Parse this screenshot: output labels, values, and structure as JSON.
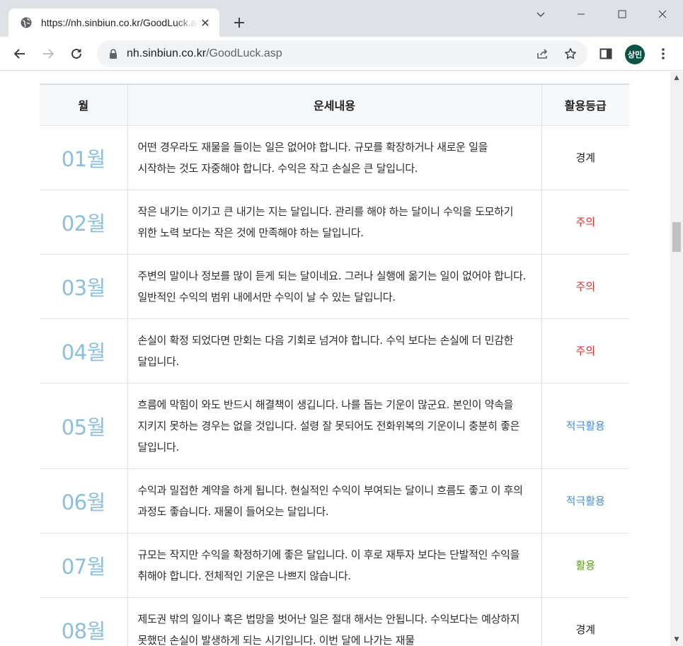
{
  "browser": {
    "tab_title": "https://nh.sinbiun.co.kr/GoodLuck.asp",
    "url_domain": "nh.sinbiun.co.kr",
    "url_path": "/GoodLuck.asp",
    "profile_initials": "상민"
  },
  "table": {
    "headers": {
      "month": "월",
      "content": "운세내용",
      "grade": "활용등급"
    },
    "rows": [
      {
        "month": "01월",
        "content": "어떤 경우라도 재물을 들이는 일은 없어야 합니다. 규모를 확장하거나 새로운 일을 시작하는 것도 자중해야 합니다. 수익은 작고 손실은 큰 달입니다.",
        "grade": "경계",
        "grade_color": "#222222"
      },
      {
        "month": "02월",
        "content": "작은 내기는 이기고 큰 내기는 지는 달입니다. 관리를 해야 하는 달이니 수익을 도모하기 위한 노력 보다는 작은 것에 만족해야 하는 달입니다.",
        "grade": "주의",
        "grade_color": "#e0312b"
      },
      {
        "month": "03월",
        "content": "주변의 말이나 정보를 많이 듣게 되는 달이네요. 그러나 실행에 옮기는 일이 없어야 합니다. 일반적인 수익의 범위 내에서만 수익이 날 수 있는 달입니다.",
        "grade": "주의",
        "grade_color": "#e0312b"
      },
      {
        "month": "04월",
        "content": "손실이 확정 되었다면 만회는 다음 기회로 넘겨야 합니다. 수익 보다는 손실에 더 민감한 달입니다.",
        "grade": "주의",
        "grade_color": "#e0312b"
      },
      {
        "month": "05월",
        "content": "흐름에 막힘이 와도 반드시 해결책이 생깁니다. 나를 돕는 기운이 많군요. 본인이 약속을 지키지 못하는 경우는 없을 것입니다. 설령 잘 못되어도 전화위복의 기운이니 충분히 좋은 달입니다.",
        "grade": "적극활용",
        "grade_color": "#3d8ee0"
      },
      {
        "month": "06월",
        "content": "수익과 밀접한 계약을 하게 됩니다. 현실적인 수익이 부여되는 달이니 흐름도 좋고 이 후의 과정도 좋습니다. 재물이 들어오는 달입니다.",
        "grade": "적극활용",
        "grade_color": "#3d8ee0"
      },
      {
        "month": "07월",
        "content": "규모는 작지만 수익을 확정하기에 좋은 달입니다. 이 후로 재투자 보다는 단발적인 수익을 취해야 합니다. 전체적인 기운은 나쁘지 않습니다.",
        "grade": "활용",
        "grade_color": "#5b9a1a"
      },
      {
        "month": "08월",
        "content": "제도권 밖의 일이나 혹은 법망을 벗어난 일은 절대 해서는 안됩니다. 수익보다는 예상하지 못했던 손실이 발생하게 되는 시기입니다. 이번 달에 나가는 재물",
        "grade": "경계",
        "grade_color": "#222222"
      }
    ]
  }
}
